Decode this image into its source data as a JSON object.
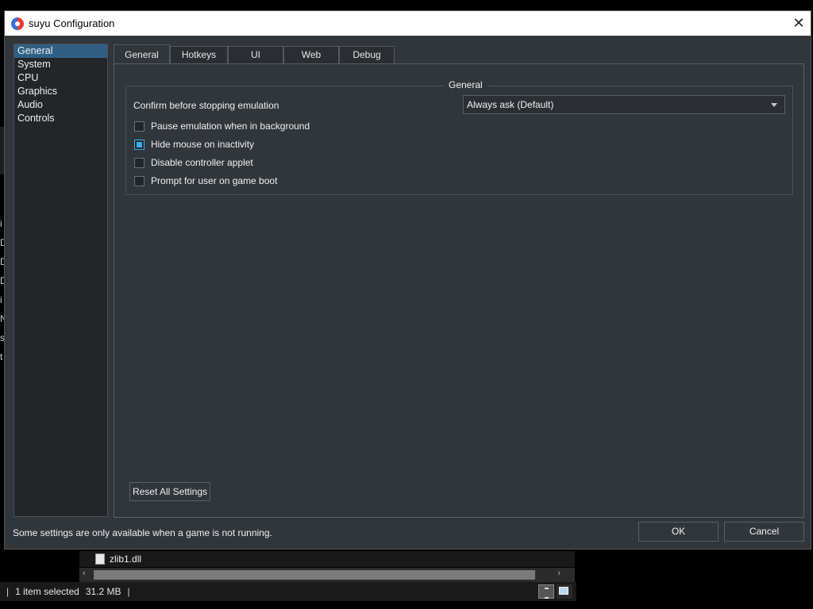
{
  "dialog": {
    "title": "suyu Configuration",
    "close_glyph": "✕",
    "footer_note": "Some settings are only available when a game is not running.",
    "ok_label": "OK",
    "cancel_label": "Cancel"
  },
  "sidebar": {
    "items": [
      {
        "label": "General",
        "active": true
      },
      {
        "label": "System"
      },
      {
        "label": "CPU"
      },
      {
        "label": "Graphics"
      },
      {
        "label": "Audio"
      },
      {
        "label": "Controls"
      }
    ]
  },
  "tabs": [
    {
      "label": "General",
      "active": true
    },
    {
      "label": "Hotkeys"
    },
    {
      "label": "UI"
    },
    {
      "label": "Web"
    },
    {
      "label": "Debug"
    }
  ],
  "general": {
    "group_title": "General",
    "confirm_label": "Confirm before stopping emulation",
    "confirm_value": "Always ask (Default)",
    "checks": [
      {
        "label": "Pause emulation when in background",
        "checked": false
      },
      {
        "label": "Hide mouse on inactivity",
        "checked": true
      },
      {
        "label": "Disable controller applet",
        "checked": false
      },
      {
        "label": "Prompt for user on game boot",
        "checked": false
      }
    ],
    "reset_label": "Reset All Settings"
  },
  "explorer": {
    "file_name": "zlib1.dll",
    "status_selected": "1 item selected",
    "status_size": "31.2 MB",
    "sep": "|"
  }
}
